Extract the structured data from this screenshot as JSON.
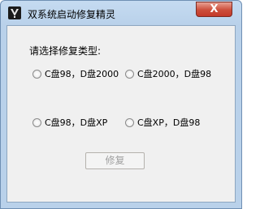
{
  "window": {
    "title": "双系统启动修复精灵",
    "close_label": "X"
  },
  "main": {
    "prompt": "请选择修复类型:",
    "options": [
      {
        "label": "C盘98，D盘2000",
        "selected": false
      },
      {
        "label": "C盘2000，D盘98",
        "selected": false
      },
      {
        "label": "C盘98，D盘XP",
        "selected": false
      },
      {
        "label": "C盘XP，D盘98",
        "selected": false
      }
    ],
    "repair_label": "修复",
    "repair_enabled": false
  }
}
